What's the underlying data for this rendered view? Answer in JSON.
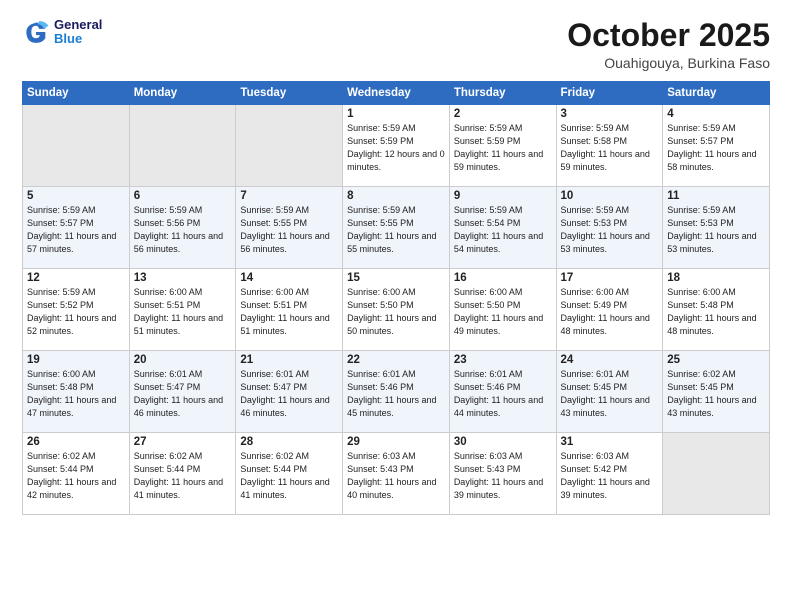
{
  "logo": {
    "line1": "General",
    "line2": "Blue"
  },
  "title": "October 2025",
  "location": "Ouahigouya, Burkina Faso",
  "days_of_week": [
    "Sunday",
    "Monday",
    "Tuesday",
    "Wednesday",
    "Thursday",
    "Friday",
    "Saturday"
  ],
  "weeks": [
    [
      {
        "day": "",
        "sunrise": "",
        "sunset": "",
        "daylight": "",
        "empty": true
      },
      {
        "day": "",
        "sunrise": "",
        "sunset": "",
        "daylight": "",
        "empty": true
      },
      {
        "day": "",
        "sunrise": "",
        "sunset": "",
        "daylight": "",
        "empty": true
      },
      {
        "day": "1",
        "sunrise": "Sunrise: 5:59 AM",
        "sunset": "Sunset: 5:59 PM",
        "daylight": "Daylight: 12 hours and 0 minutes."
      },
      {
        "day": "2",
        "sunrise": "Sunrise: 5:59 AM",
        "sunset": "Sunset: 5:59 PM",
        "daylight": "Daylight: 11 hours and 59 minutes."
      },
      {
        "day": "3",
        "sunrise": "Sunrise: 5:59 AM",
        "sunset": "Sunset: 5:58 PM",
        "daylight": "Daylight: 11 hours and 59 minutes."
      },
      {
        "day": "4",
        "sunrise": "Sunrise: 5:59 AM",
        "sunset": "Sunset: 5:57 PM",
        "daylight": "Daylight: 11 hours and 58 minutes."
      }
    ],
    [
      {
        "day": "5",
        "sunrise": "Sunrise: 5:59 AM",
        "sunset": "Sunset: 5:57 PM",
        "daylight": "Daylight: 11 hours and 57 minutes."
      },
      {
        "day": "6",
        "sunrise": "Sunrise: 5:59 AM",
        "sunset": "Sunset: 5:56 PM",
        "daylight": "Daylight: 11 hours and 56 minutes."
      },
      {
        "day": "7",
        "sunrise": "Sunrise: 5:59 AM",
        "sunset": "Sunset: 5:55 PM",
        "daylight": "Daylight: 11 hours and 56 minutes."
      },
      {
        "day": "8",
        "sunrise": "Sunrise: 5:59 AM",
        "sunset": "Sunset: 5:55 PM",
        "daylight": "Daylight: 11 hours and 55 minutes."
      },
      {
        "day": "9",
        "sunrise": "Sunrise: 5:59 AM",
        "sunset": "Sunset: 5:54 PM",
        "daylight": "Daylight: 11 hours and 54 minutes."
      },
      {
        "day": "10",
        "sunrise": "Sunrise: 5:59 AM",
        "sunset": "Sunset: 5:53 PM",
        "daylight": "Daylight: 11 hours and 53 minutes."
      },
      {
        "day": "11",
        "sunrise": "Sunrise: 5:59 AM",
        "sunset": "Sunset: 5:53 PM",
        "daylight": "Daylight: 11 hours and 53 minutes."
      }
    ],
    [
      {
        "day": "12",
        "sunrise": "Sunrise: 5:59 AM",
        "sunset": "Sunset: 5:52 PM",
        "daylight": "Daylight: 11 hours and 52 minutes."
      },
      {
        "day": "13",
        "sunrise": "Sunrise: 6:00 AM",
        "sunset": "Sunset: 5:51 PM",
        "daylight": "Daylight: 11 hours and 51 minutes."
      },
      {
        "day": "14",
        "sunrise": "Sunrise: 6:00 AM",
        "sunset": "Sunset: 5:51 PM",
        "daylight": "Daylight: 11 hours and 51 minutes."
      },
      {
        "day": "15",
        "sunrise": "Sunrise: 6:00 AM",
        "sunset": "Sunset: 5:50 PM",
        "daylight": "Daylight: 11 hours and 50 minutes."
      },
      {
        "day": "16",
        "sunrise": "Sunrise: 6:00 AM",
        "sunset": "Sunset: 5:50 PM",
        "daylight": "Daylight: 11 hours and 49 minutes."
      },
      {
        "day": "17",
        "sunrise": "Sunrise: 6:00 AM",
        "sunset": "Sunset: 5:49 PM",
        "daylight": "Daylight: 11 hours and 48 minutes."
      },
      {
        "day": "18",
        "sunrise": "Sunrise: 6:00 AM",
        "sunset": "Sunset: 5:48 PM",
        "daylight": "Daylight: 11 hours and 48 minutes."
      }
    ],
    [
      {
        "day": "19",
        "sunrise": "Sunrise: 6:00 AM",
        "sunset": "Sunset: 5:48 PM",
        "daylight": "Daylight: 11 hours and 47 minutes."
      },
      {
        "day": "20",
        "sunrise": "Sunrise: 6:01 AM",
        "sunset": "Sunset: 5:47 PM",
        "daylight": "Daylight: 11 hours and 46 minutes."
      },
      {
        "day": "21",
        "sunrise": "Sunrise: 6:01 AM",
        "sunset": "Sunset: 5:47 PM",
        "daylight": "Daylight: 11 hours and 46 minutes."
      },
      {
        "day": "22",
        "sunrise": "Sunrise: 6:01 AM",
        "sunset": "Sunset: 5:46 PM",
        "daylight": "Daylight: 11 hours and 45 minutes."
      },
      {
        "day": "23",
        "sunrise": "Sunrise: 6:01 AM",
        "sunset": "Sunset: 5:46 PM",
        "daylight": "Daylight: 11 hours and 44 minutes."
      },
      {
        "day": "24",
        "sunrise": "Sunrise: 6:01 AM",
        "sunset": "Sunset: 5:45 PM",
        "daylight": "Daylight: 11 hours and 43 minutes."
      },
      {
        "day": "25",
        "sunrise": "Sunrise: 6:02 AM",
        "sunset": "Sunset: 5:45 PM",
        "daylight": "Daylight: 11 hours and 43 minutes."
      }
    ],
    [
      {
        "day": "26",
        "sunrise": "Sunrise: 6:02 AM",
        "sunset": "Sunset: 5:44 PM",
        "daylight": "Daylight: 11 hours and 42 minutes."
      },
      {
        "day": "27",
        "sunrise": "Sunrise: 6:02 AM",
        "sunset": "Sunset: 5:44 PM",
        "daylight": "Daylight: 11 hours and 41 minutes."
      },
      {
        "day": "28",
        "sunrise": "Sunrise: 6:02 AM",
        "sunset": "Sunset: 5:44 PM",
        "daylight": "Daylight: 11 hours and 41 minutes."
      },
      {
        "day": "29",
        "sunrise": "Sunrise: 6:03 AM",
        "sunset": "Sunset: 5:43 PM",
        "daylight": "Daylight: 11 hours and 40 minutes."
      },
      {
        "day": "30",
        "sunrise": "Sunrise: 6:03 AM",
        "sunset": "Sunset: 5:43 PM",
        "daylight": "Daylight: 11 hours and 39 minutes."
      },
      {
        "day": "31",
        "sunrise": "Sunrise: 6:03 AM",
        "sunset": "Sunset: 5:42 PM",
        "daylight": "Daylight: 11 hours and 39 minutes."
      },
      {
        "day": "",
        "sunrise": "",
        "sunset": "",
        "daylight": "",
        "empty": true
      }
    ]
  ]
}
